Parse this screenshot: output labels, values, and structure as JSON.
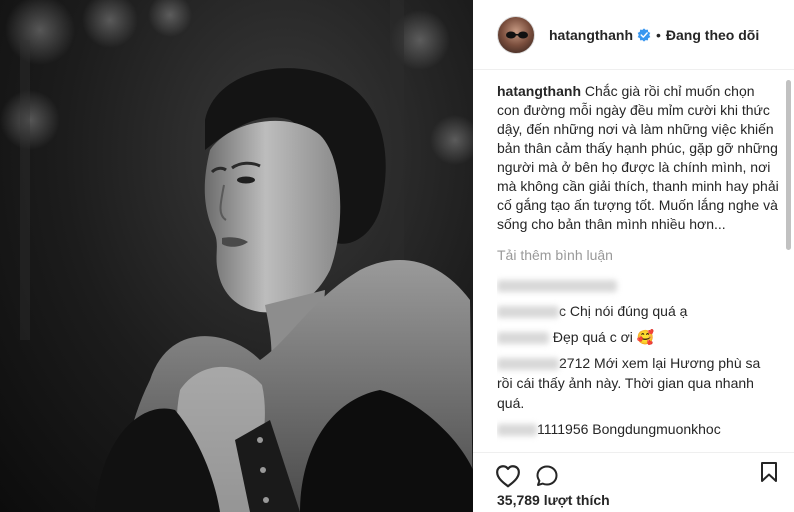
{
  "header": {
    "username": "hatangthanh",
    "verified_icon": "verified-badge-icon",
    "separator": "•",
    "follow_label": "Đang theo dõi"
  },
  "caption": {
    "username": "hatangthanh",
    "text": "Chắc già rồi chỉ muốn chọn con đường mỗi ngày đều mỉm cười khi thức dậy, đến những nơi và làm những việc khiến bản thân cảm thấy hạnh phúc, gặp gỡ những người mà ở bên họ được là chính mình, nơi mà không cần giải thích, thanh minh hay phải cố gắng tạo ấn tượng tốt. Muốn lắng nghe và sống cho bản thân mình nhiều hơn..."
  },
  "load_more": "Tải thêm bình luận",
  "comments": [
    {
      "username_fragment": "",
      "text": ""
    },
    {
      "username_fragment": "c",
      "text": "Chị nói đúng quá ạ"
    },
    {
      "username_fragment": "",
      "text": "Đẹp quá c ơi 🥰"
    },
    {
      "username_fragment": "2712",
      "text": "Mới xem lại Hương phù sa rồi cái thấy ảnh này. Thời gian qua nhanh quá."
    },
    {
      "username_fragment": "1111956",
      "text": "Bongdungmuonkhoc"
    }
  ],
  "actions": {
    "like_icon": "heart-icon",
    "comment_icon": "comment-icon",
    "save_icon": "bookmark-icon"
  },
  "likes": "35,789 lượt thích",
  "colors": {
    "verified_blue": "#3897f0",
    "text": "#262626",
    "muted": "#999999"
  }
}
